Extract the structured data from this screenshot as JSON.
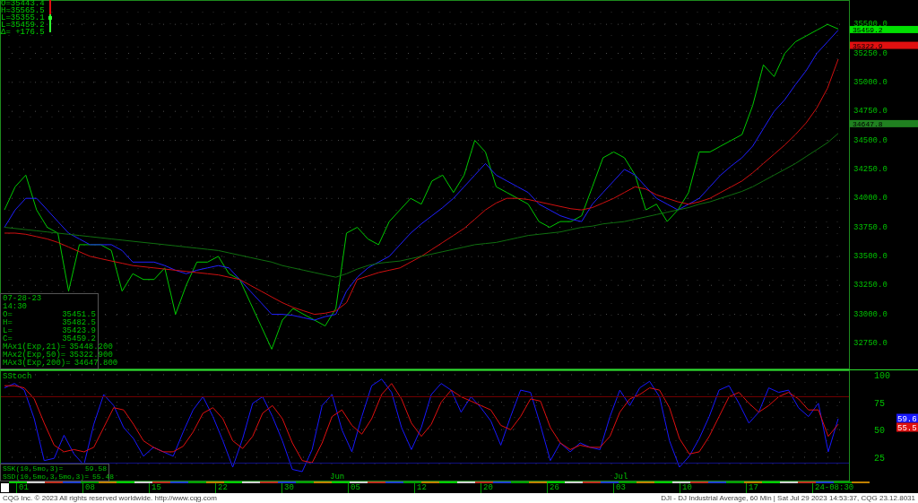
{
  "quote_readout": [
    "O=35443.4",
    "H=35565.5",
    "L=35355.1",
    "L=35459.2",
    "Δ= +176.5"
  ],
  "price_chart": {
    "chart_data": {
      "type": "line",
      "grid": true,
      "ylim": [
        32525,
        35710
      ],
      "yticks": [
        {
          "value": 32750,
          "label": "32750.0"
        },
        {
          "value": 33000,
          "label": "33000.0"
        },
        {
          "value": 33250,
          "label": "33250.0"
        },
        {
          "value": 33500,
          "label": "33500.0"
        },
        {
          "value": 33750,
          "label": "33750.0"
        },
        {
          "value": 34000,
          "label": "34000.0"
        },
        {
          "value": 34250,
          "label": "34250.0"
        },
        {
          "value": 34500,
          "label": "34500.0"
        },
        {
          "value": 34750,
          "label": "34750.0"
        },
        {
          "value": 35000,
          "label": "35000.0"
        },
        {
          "value": 35250,
          "label": "35250.0"
        },
        {
          "value": 35500,
          "label": "35500.0"
        }
      ],
      "series": [
        {
          "color": "#00c800",
          "values": [
            33900,
            34100,
            34200,
            33900,
            33750,
            33700,
            33200,
            33600,
            33600,
            33600,
            33550,
            33200,
            33350,
            33300,
            33300,
            33400,
            33000,
            33250,
            33450,
            33450,
            33500,
            33350,
            33300,
            33100,
            32900,
            32700,
            32950,
            33050,
            33000,
            32950,
            32900,
            33050,
            33700,
            33750,
            33650,
            33600,
            33800,
            33900,
            34000,
            33950,
            34150,
            34200,
            34050,
            34200,
            34500,
            34400,
            34100,
            34050,
            34000,
            33950,
            33800,
            33750,
            33800,
            33800,
            33850,
            34100,
            34350,
            34400,
            34350,
            34200,
            33900,
            33950,
            33800,
            33900,
            34050,
            34400,
            34400,
            34450,
            34500,
            34550,
            34800,
            35150,
            35050,
            35250,
            35350,
            35400,
            35450,
            35500,
            35460
          ]
        },
        {
          "color": "#2020ff",
          "values": [
            33750,
            33900,
            34000,
            34000,
            33900,
            33800,
            33700,
            33650,
            33600,
            33600,
            33600,
            33550,
            33450,
            33450,
            33450,
            33420,
            33380,
            33350,
            33380,
            33400,
            33420,
            33400,
            33300,
            33200,
            33100,
            33000,
            33000,
            32990,
            32970,
            32950,
            32980,
            33000,
            33200,
            33320,
            33400,
            33450,
            33500,
            33600,
            33700,
            33780,
            33850,
            33920,
            34000,
            34100,
            34200,
            34300,
            34200,
            34150,
            34100,
            34050,
            33950,
            33900,
            33850,
            33820,
            33800,
            33950,
            34050,
            34150,
            34250,
            34200,
            34100,
            34000,
            33950,
            33900,
            33950,
            34000,
            34100,
            34200,
            34280,
            34350,
            34450,
            34600,
            34750,
            34850,
            34980,
            35100,
            35250,
            35350,
            35450
          ]
        },
        {
          "color": "#d01010",
          "values": [
            33700,
            33700,
            33690,
            33670,
            33650,
            33620,
            33580,
            33540,
            33500,
            33480,
            33460,
            33440,
            33420,
            33410,
            33400,
            33390,
            33380,
            33370,
            33360,
            33350,
            33340,
            33320,
            33300,
            33250,
            33200,
            33150,
            33100,
            33060,
            33030,
            33000,
            33010,
            33030,
            33100,
            33300,
            33330,
            33360,
            33380,
            33400,
            33450,
            33500,
            33560,
            33620,
            33680,
            33740,
            33820,
            33900,
            33960,
            34000,
            34000,
            33990,
            33970,
            33950,
            33930,
            33910,
            33900,
            33920,
            33960,
            34000,
            34050,
            34100,
            34080,
            34030,
            34000,
            33970,
            33950,
            33970,
            34000,
            34050,
            34100,
            34150,
            34220,
            34300,
            34380,
            34460,
            34550,
            34650,
            34780,
            34950,
            35200
          ]
        },
        {
          "color": "#107010",
          "values": [
            33750,
            33740,
            33730,
            33720,
            33710,
            33700,
            33690,
            33680,
            33670,
            33660,
            33650,
            33640,
            33630,
            33620,
            33610,
            33600,
            33590,
            33580,
            33570,
            33560,
            33550,
            33530,
            33510,
            33490,
            33470,
            33450,
            33420,
            33400,
            33380,
            33360,
            33340,
            33320,
            33350,
            33390,
            33420,
            33440,
            33450,
            33460,
            33480,
            33500,
            33520,
            33540,
            33560,
            33580,
            33600,
            33610,
            33620,
            33640,
            33660,
            33680,
            33690,
            33700,
            33710,
            33730,
            33750,
            33760,
            33780,
            33790,
            33800,
            33820,
            33840,
            33860,
            33880,
            33900,
            33920,
            33950,
            33970,
            34000,
            34030,
            34060,
            34100,
            34150,
            34200,
            34250,
            34300,
            34360,
            34420,
            34480,
            34560
          ]
        }
      ]
    },
    "price_tags": [
      {
        "text": "35459.2",
        "color": "#00e000"
      },
      {
        "text": "35322.9",
        "color": "#e01010"
      },
      {
        "text": "34647.8",
        "color": "#208020"
      }
    ],
    "data_window": {
      "date": "07-28-23",
      "time": "14:30",
      "rows": [
        {
          "label": "O=",
          "value": "35451.5"
        },
        {
          "label": "H=",
          "value": "35482.5"
        },
        {
          "label": "L=",
          "value": "35423.9"
        },
        {
          "label": "C=",
          "value": "35459.2"
        },
        {
          "label": "MAx1(Exp,21)=",
          "value": "35448.200"
        },
        {
          "label": "MAx2(Exp,50)=",
          "value": "35322.900"
        },
        {
          "label": "MAx3(Exp,200)=",
          "value": "34647.800"
        }
      ]
    }
  },
  "stoch_chart": {
    "title": "SStoch",
    "chart_data": {
      "type": "line",
      "grid": true,
      "ylim": [
        3,
        104
      ],
      "yticks": [
        25,
        50,
        75,
        100
      ],
      "series": [
        {
          "color": "#1818ff",
          "values": [
            88,
            92,
            86,
            60,
            22,
            24,
            45,
            28,
            18,
            55,
            82,
            72,
            52,
            42,
            26,
            34,
            30,
            26,
            48,
            68,
            80,
            62,
            40,
            16,
            42,
            74,
            80,
            62,
            40,
            14,
            12,
            32,
            72,
            82,
            50,
            30,
            62,
            90,
            96,
            84,
            52,
            32,
            52,
            82,
            92,
            86,
            66,
            80,
            70,
            58,
            36,
            62,
            86,
            84,
            54,
            22,
            38,
            30,
            38,
            34,
            32,
            62,
            86,
            72,
            88,
            94,
            80,
            40,
            16,
            26,
            42,
            62,
            86,
            90,
            74,
            56,
            66,
            88,
            84,
            86,
            70,
            62,
            74,
            30,
            60
          ]
        },
        {
          "color": "#e01010",
          "values": [
            90,
            90,
            88,
            78,
            56,
            36,
            30,
            32,
            30,
            34,
            52,
            70,
            68,
            55,
            40,
            34,
            30,
            30,
            35,
            48,
            65,
            70,
            60,
            40,
            33,
            44,
            65,
            72,
            60,
            38,
            22,
            20,
            38,
            62,
            68,
            54,
            46,
            60,
            82,
            92,
            78,
            56,
            44,
            55,
            75,
            86,
            80,
            76,
            72,
            68,
            54,
            50,
            62,
            78,
            76,
            52,
            38,
            32,
            36,
            34,
            34,
            44,
            66,
            78,
            82,
            88,
            86,
            70,
            42,
            28,
            30,
            44,
            62,
            80,
            84,
            74,
            66,
            72,
            80,
            84,
            78,
            68,
            68,
            44,
            55
          ]
        }
      ]
    },
    "months": [
      "Jun",
      "Jul"
    ],
    "tags": [
      {
        "text": "59.6",
        "color": "#1818ff"
      },
      {
        "text": "55.5",
        "color": "#e01010"
      }
    ],
    "legend": [
      {
        "label": "SSK(10,5mo,3)=",
        "value": "59.58"
      },
      {
        "label": "SSD(10,5mo,3,5mo,3)=",
        "value": "55.48"
      }
    ]
  },
  "time_axis": [
    "01",
    "08",
    "15",
    "22",
    "30",
    "05",
    "12",
    "20",
    "26",
    "03",
    "10",
    "17",
    "24-08:30"
  ],
  "footer": {
    "copyright": "CQG Inc. © 2023 All rights reserved worldwide. http://www.cqg.com",
    "info": "DJI - DJ Industrial Average, 60 Min | Sat Jul 29 2023 14:53:37, CQG 23.12.8031"
  }
}
